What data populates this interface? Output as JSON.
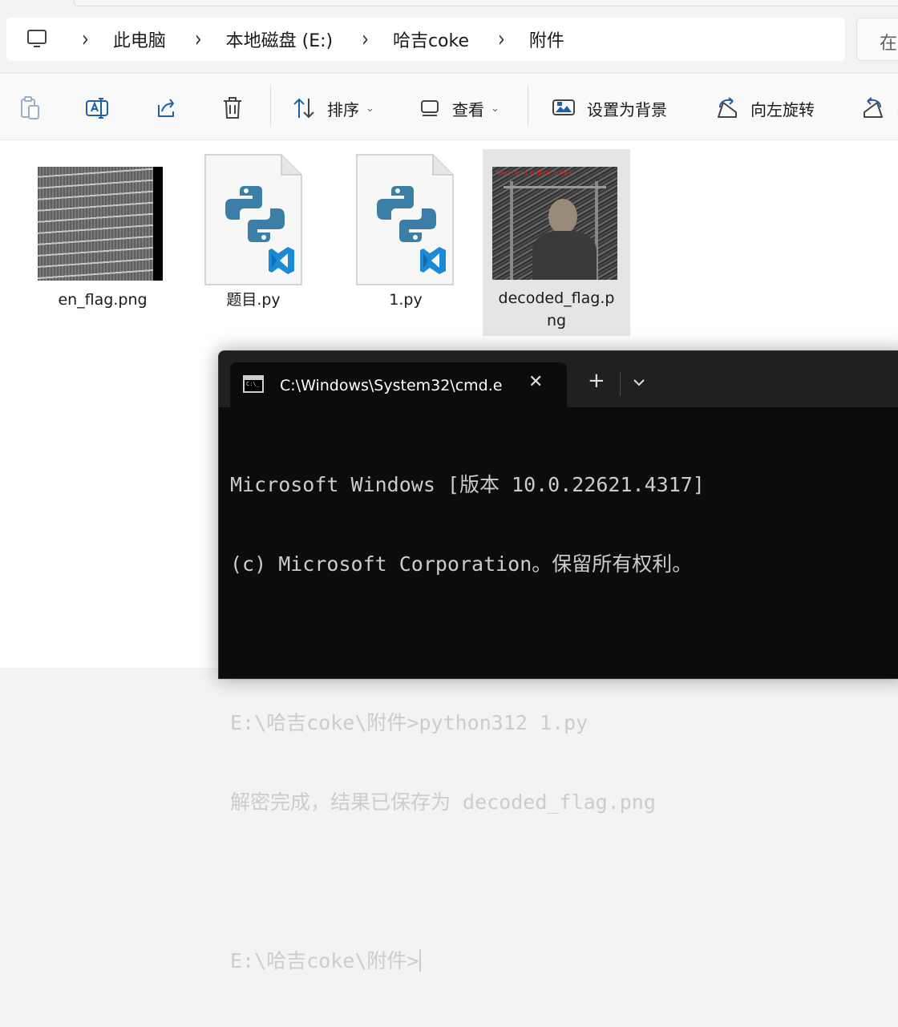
{
  "breadcrumb": {
    "items": [
      "此电脑",
      "本地磁盘 (E:)",
      "哈吉coke",
      "附件"
    ],
    "search_partial": "在"
  },
  "toolbar": {
    "sort_label": "排序",
    "view_label": "查看",
    "set_background_label": "设置为背景",
    "rotate_left_label": "向左旋转",
    "rotate_right_partial": "向"
  },
  "files": [
    {
      "name": "en_flag.png",
      "type": "image"
    },
    {
      "name": "题目.py",
      "type": "python"
    },
    {
      "name": "1.py",
      "type": "python"
    },
    {
      "name_line1": "decoded_flag.p",
      "name_line2": "ng",
      "type": "image",
      "selected": true,
      "overlay_text": "flag{hello_hajimi_coke}"
    }
  ],
  "terminal": {
    "tab_title": "C:\\Windows\\System32\\cmd.e",
    "lines": [
      "Microsoft Windows [版本 10.0.22621.4317]",
      "(c) Microsoft Corporation。保留所有权利。",
      "",
      "E:\\哈吉coke\\附件>python312 1.py",
      "解密完成，结果已保存为 decoded_flag.png",
      "",
      "E:\\哈吉coke\\附件>"
    ]
  },
  "colors": {
    "accent_blue": "#1f5fa8",
    "python_blue": "#3d7ea6",
    "vscode_blue": "#1a8ad4",
    "terminal_bg": "#0c0c0c",
    "terminal_text": "#cccccc"
  }
}
